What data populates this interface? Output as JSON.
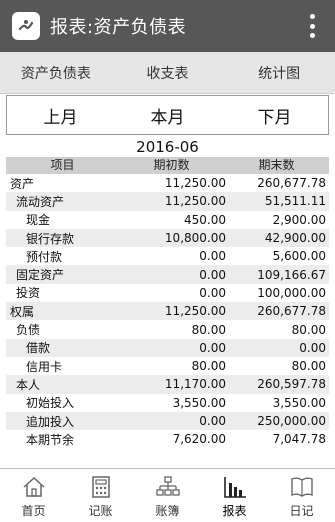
{
  "app_bar": {
    "title": "报表:资产负债表",
    "icon": "app-logo-icon",
    "menu_icon": "overflow-menu-icon"
  },
  "tabs": [
    {
      "label": "资产负债表"
    },
    {
      "label": "收支表"
    },
    {
      "label": "统计图"
    }
  ],
  "period": {
    "prev": "上月",
    "current": "本月",
    "next": "下月"
  },
  "month": "2016-06",
  "table": {
    "headers": {
      "item": "项目",
      "begin": "期初数",
      "end": "期末数"
    },
    "rows": [
      {
        "item": "资产",
        "begin": "11,250.00",
        "end": "260,677.78"
      },
      {
        "item": "流动资产",
        "begin": "11,250.00",
        "end": "51,511.11"
      },
      {
        "item": "现金",
        "begin": "450.00",
        "end": "2,900.00"
      },
      {
        "item": "银行存款",
        "begin": "10,800.00",
        "end": "42,900.00"
      },
      {
        "item": "预付款",
        "begin": "0.00",
        "end": "5,600.00"
      },
      {
        "item": "固定资产",
        "begin": "0.00",
        "end": "109,166.67"
      },
      {
        "item": "投资",
        "begin": "0.00",
        "end": "100,000.00"
      },
      {
        "item": "权属",
        "begin": "11,250.00",
        "end": "260,677.78"
      },
      {
        "item": "负债",
        "begin": "80.00",
        "end": "80.00"
      },
      {
        "item": "借款",
        "begin": "0.00",
        "end": "0.00"
      },
      {
        "item": "信用卡",
        "begin": "80.00",
        "end": "80.00"
      },
      {
        "item": "本人",
        "begin": "11,170.00",
        "end": "260,597.78"
      },
      {
        "item": "初始投入",
        "begin": "3,550.00",
        "end": "3,550.00"
      },
      {
        "item": "追加投入",
        "begin": "0.00",
        "end": "250,000.00"
      },
      {
        "item": "本期节余",
        "begin": "7,620.00",
        "end": "7,047.78"
      }
    ]
  },
  "bottom_nav": [
    {
      "label": "首页",
      "icon": "home-icon"
    },
    {
      "label": "记账",
      "icon": "calculator-icon"
    },
    {
      "label": "账簿",
      "icon": "ledger-tree-icon"
    },
    {
      "label": "报表",
      "icon": "bar-chart-icon",
      "active": true
    },
    {
      "label": "日记",
      "icon": "diary-book-icon"
    }
  ]
}
